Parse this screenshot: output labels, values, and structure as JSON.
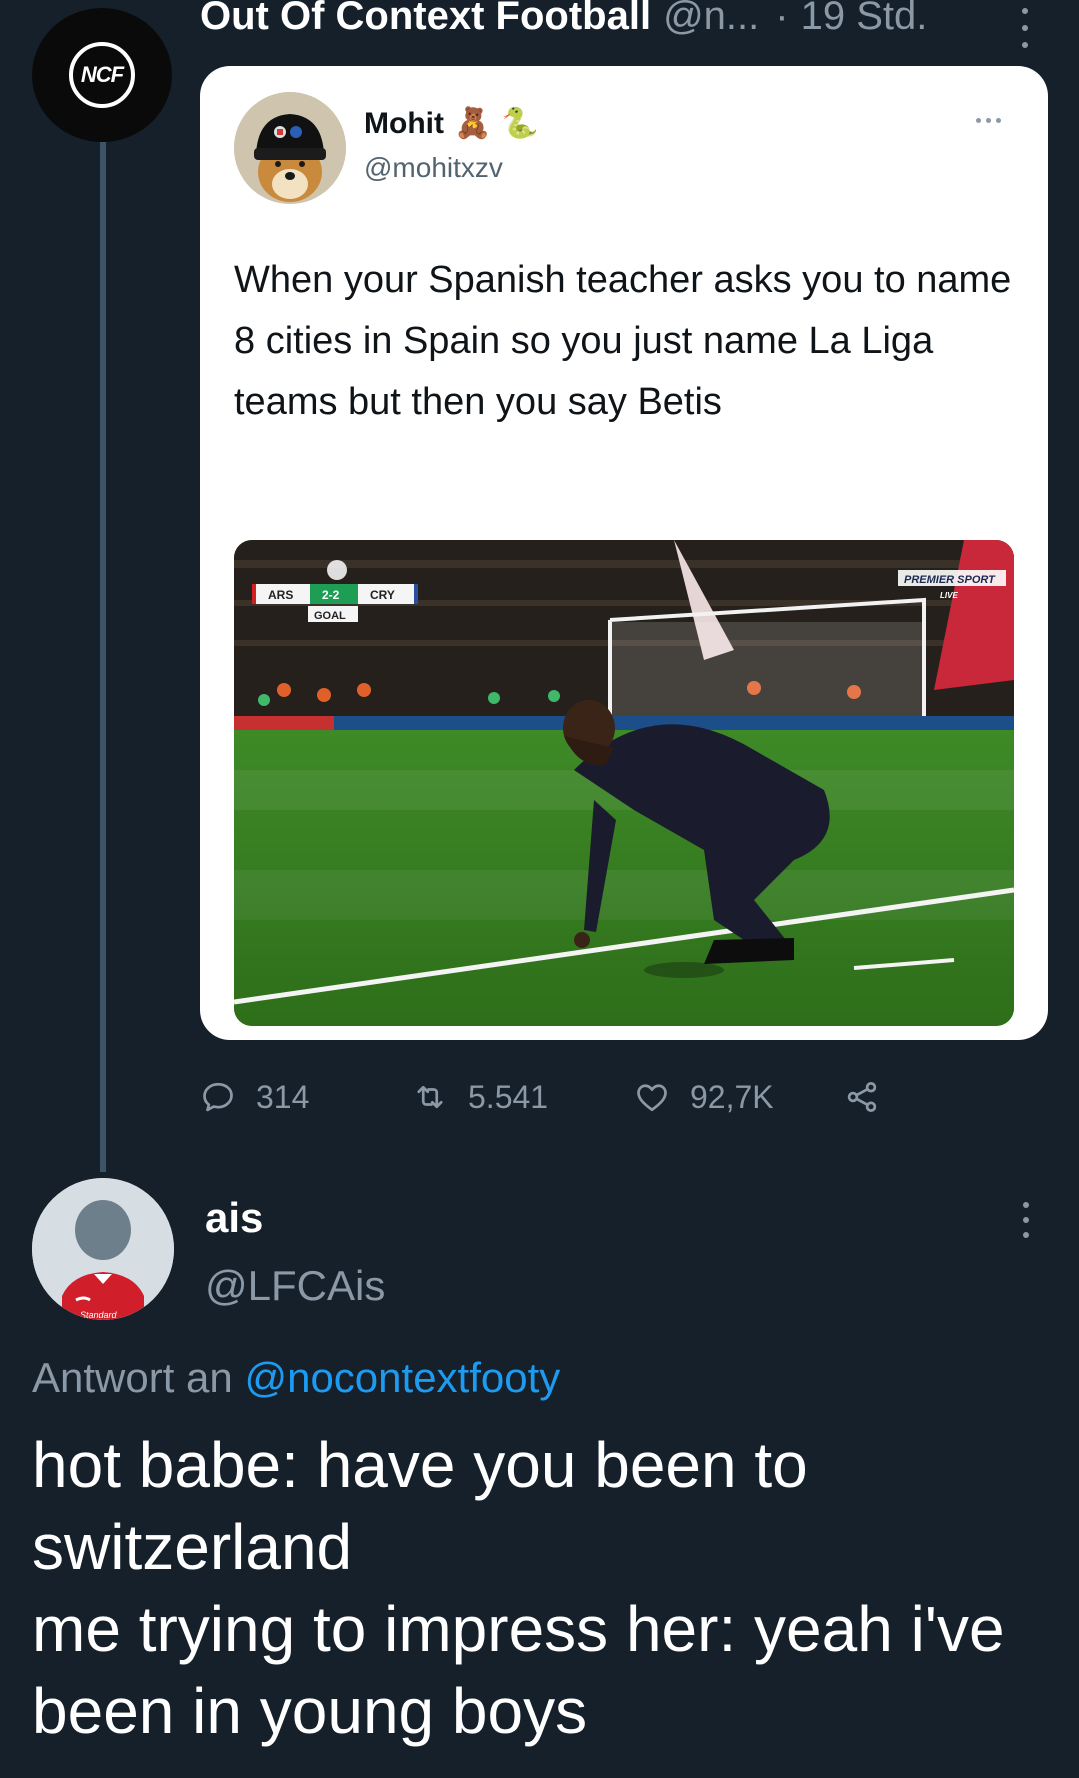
{
  "top_tweet": {
    "author_name": "Out Of Context Football",
    "author_handle": "@n...",
    "separator": "·",
    "time": "19 Std.",
    "avatar_logo": "NCF",
    "stats": {
      "replies": "314",
      "retweets": "5.541",
      "likes": "92,7K"
    },
    "icons": [
      "reply-icon",
      "retweet-icon",
      "like-icon",
      "share-icon",
      "more-icon"
    ]
  },
  "embedded_tweet": {
    "author_name": "Mohit",
    "author_emojis": [
      "🧸",
      "🐍"
    ],
    "author_handle": "@mohitxzv",
    "text": "When your Spanish teacher asks you to name 8 cities in Spain so you just name La Liga teams but then you say Betis",
    "media": {
      "scorebug_home": "ARS",
      "scorebug_score": "2-2",
      "scorebug_away": "CRY",
      "scorebug_event": "GOAL",
      "broadcaster": "PREMIER SPORT",
      "broadcaster_live": "LIVE"
    }
  },
  "reply": {
    "author_name": "ais",
    "author_handle": "@LFCAis",
    "reply_prefix": "Antwort an",
    "reply_to": "@nocontextfooty",
    "text_lines": [
      "hot babe: have you been to",
      "switzerland",
      "me trying to impress her: yeah i've",
      "been in young boys"
    ]
  },
  "colors": {
    "background": "#15202b",
    "secondary_text": "#8b98a5",
    "link": "#1d9bf0",
    "card_background": "#ffffff"
  }
}
